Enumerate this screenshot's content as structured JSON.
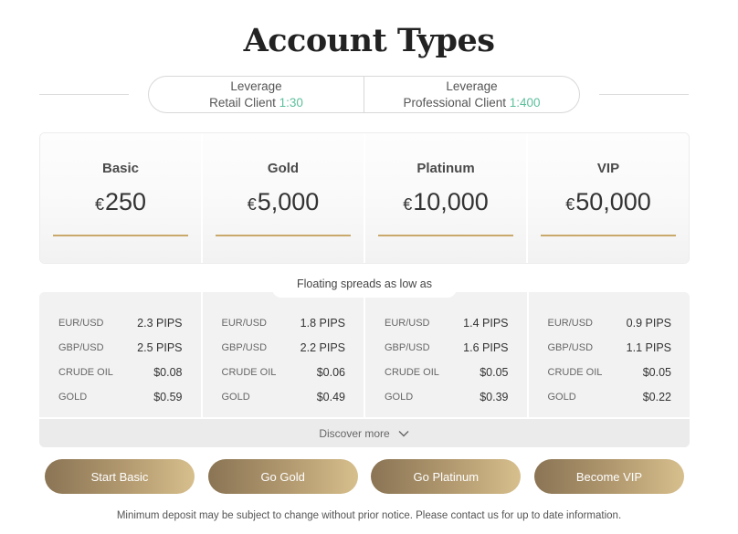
{
  "page": {
    "title": "Account Types"
  },
  "leverage": [
    {
      "heading": "Leverage",
      "label": "Retail Client",
      "ratio": "1:30"
    },
    {
      "heading": "Leverage",
      "label": "Professional Client",
      "ratio": "1:400"
    }
  ],
  "plans": [
    {
      "name": "Basic",
      "currency": "€",
      "amount": "250"
    },
    {
      "name": "Gold",
      "currency": "€",
      "amount": "5,000"
    },
    {
      "name": "Platinum",
      "currency": "€",
      "amount": "10,000"
    },
    {
      "name": "VIP",
      "currency": "€",
      "amount": "50,000"
    }
  ],
  "spreads": {
    "label": "Floating spreads as low as",
    "columns": [
      [
        {
          "symbol": "EUR/USD",
          "value": "2.3 PIPS"
        },
        {
          "symbol": "GBP/USD",
          "value": "2.5 PIPS"
        },
        {
          "symbol": "CRUDE OIL",
          "value": "$0.08"
        },
        {
          "symbol": "GOLD",
          "value": "$0.59"
        }
      ],
      [
        {
          "symbol": "EUR/USD",
          "value": "1.8 PIPS"
        },
        {
          "symbol": "GBP/USD",
          "value": "2.2 PIPS"
        },
        {
          "symbol": "CRUDE OIL",
          "value": "$0.06"
        },
        {
          "symbol": "GOLD",
          "value": "$0.49"
        }
      ],
      [
        {
          "symbol": "EUR/USD",
          "value": "1.4 PIPS"
        },
        {
          "symbol": "GBP/USD",
          "value": "1.6 PIPS"
        },
        {
          "symbol": "CRUDE OIL",
          "value": "$0.05"
        },
        {
          "symbol": "GOLD",
          "value": "$0.39"
        }
      ],
      [
        {
          "symbol": "EUR/USD",
          "value": "0.9 PIPS"
        },
        {
          "symbol": "GBP/USD",
          "value": "1.1 PIPS"
        },
        {
          "symbol": "CRUDE OIL",
          "value": "$0.05"
        },
        {
          "symbol": "GOLD",
          "value": "$0.22"
        }
      ]
    ],
    "discover_label": "Discover more",
    "discover_icon": "chevron-down-icon"
  },
  "ctas": [
    "Start Basic",
    "Go Gold",
    "Go Platinum",
    "Become VIP"
  ],
  "disclaimer": "Minimum deposit may be subject to change without prior notice. Please contact us for up to date information.",
  "colors": {
    "accent_gold": "#c9a96b",
    "leverage_green": "#5dbf9c",
    "button_start": "#8a7454",
    "button_end": "#d7bf8d"
  }
}
